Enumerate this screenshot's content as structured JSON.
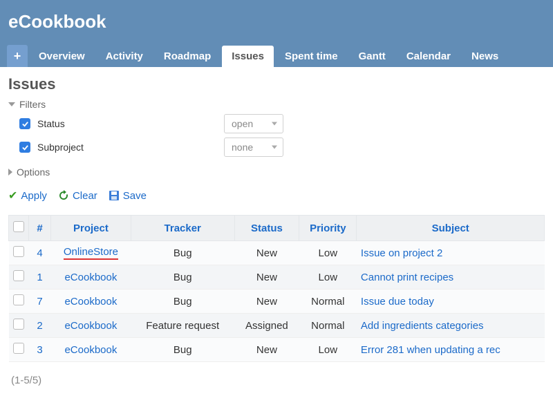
{
  "header": {
    "project_title": "eCookbook",
    "add_symbol": "+",
    "tabs": [
      "Overview",
      "Activity",
      "Roadmap",
      "Issues",
      "Spent time",
      "Gantt",
      "Calendar",
      "News"
    ],
    "active_tab": "Issues"
  },
  "page": {
    "title": "Issues"
  },
  "filters": {
    "section_label": "Filters",
    "items": [
      {
        "label": "Status",
        "value": "open"
      },
      {
        "label": "Subproject",
        "value": "none"
      }
    ]
  },
  "options": {
    "section_label": "Options"
  },
  "actions": {
    "apply": "Apply",
    "clear": "Clear",
    "save": "Save"
  },
  "table": {
    "columns": [
      "#",
      "Project",
      "Tracker",
      "Status",
      "Priority",
      "Subject"
    ],
    "rows": [
      {
        "id": "4",
        "project": "OnlineStore",
        "tracker": "Bug",
        "status": "New",
        "priority": "Low",
        "subject": "Issue on project 2",
        "highlighted": true
      },
      {
        "id": "1",
        "project": "eCookbook",
        "tracker": "Bug",
        "status": "New",
        "priority": "Low",
        "subject": "Cannot print recipes"
      },
      {
        "id": "7",
        "project": "eCookbook",
        "tracker": "Bug",
        "status": "New",
        "priority": "Normal",
        "subject": "Issue due today"
      },
      {
        "id": "2",
        "project": "eCookbook",
        "tracker": "Feature request",
        "status": "Assigned",
        "priority": "Normal",
        "subject": "Add ingredients categories"
      },
      {
        "id": "3",
        "project": "eCookbook",
        "tracker": "Bug",
        "status": "New",
        "priority": "Low",
        "subject": "Error 281 when updating a rec"
      }
    ]
  },
  "pager": "(1-5/5)"
}
